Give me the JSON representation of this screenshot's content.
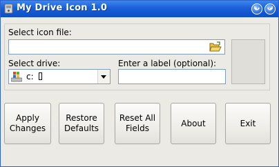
{
  "window": {
    "title": "My Drive Icon 1.0"
  },
  "form": {
    "icon_file_label": "Select icon file:",
    "icon_file_value": "",
    "drive_label": "Select drive:",
    "drive_value": "c:",
    "drive_icon": "windows-drive-icon",
    "label_field_label": "Enter a label (optional):",
    "label_value": ""
  },
  "buttons": {
    "apply": "Apply\nChanges",
    "restore": "Restore\nDefaults",
    "reset": "Reset All\nFields",
    "about": "About",
    "exit": "Exit"
  },
  "colors": {
    "titlebar": "#1a5fd7",
    "window_bg": "#eceae4",
    "input_border": "#7f9db9"
  }
}
